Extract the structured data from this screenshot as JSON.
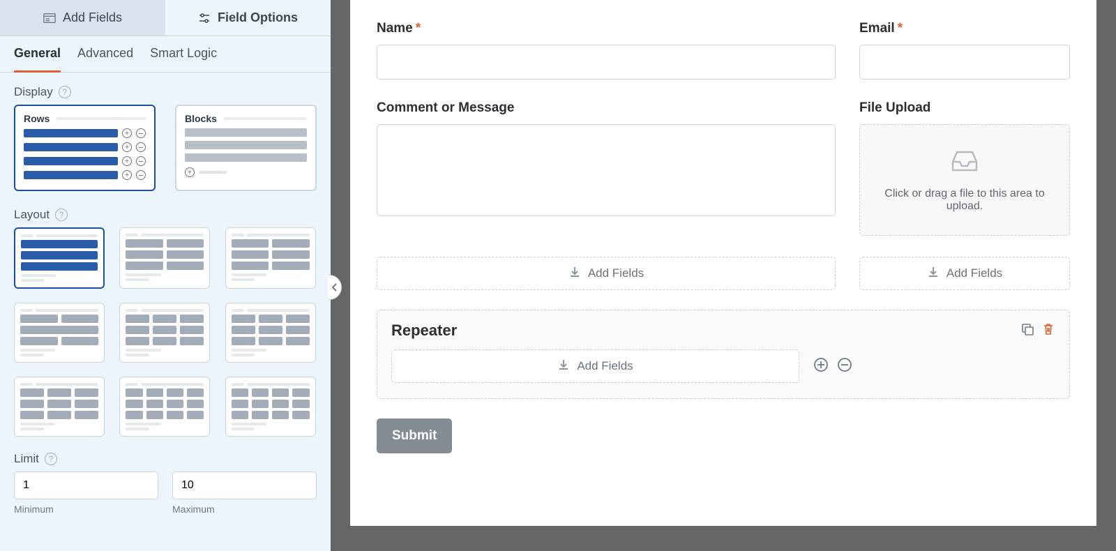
{
  "sidebar": {
    "tabs": {
      "add_fields": "Add Fields",
      "field_options": "Field Options"
    },
    "subtabs": {
      "general": "General",
      "advanced": "Advanced",
      "smart_logic": "Smart Logic"
    },
    "display": {
      "label": "Display",
      "rows": "Rows",
      "blocks": "Blocks"
    },
    "layout_label": "Layout",
    "limit": {
      "label": "Limit",
      "min": "1",
      "max": "10",
      "min_label": "Minimum",
      "max_label": "Maximum"
    }
  },
  "preview": {
    "name_label": "Name",
    "email_label": "Email",
    "comment_label": "Comment or Message",
    "upload_label": "File Upload",
    "upload_hint": "Click or drag a file to this area to upload.",
    "add_fields": "Add Fields",
    "repeater_label": "Repeater",
    "submit": "Submit"
  }
}
